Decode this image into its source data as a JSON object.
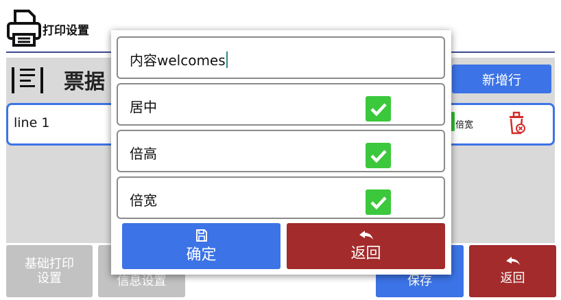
{
  "header": {
    "title": "打印设置"
  },
  "section": {
    "title": "票据",
    "add_line_label": "新增行"
  },
  "rows": [
    {
      "text": "line 1",
      "double_width_label": "倍宽"
    }
  ],
  "footer": {
    "basic_label_line1": "基础打印",
    "basic_label_line2": "设置",
    "info_label": "信息设置",
    "save_label": "保存",
    "back_label": "返回"
  },
  "dialog": {
    "content_value": "内容welcomes",
    "options": [
      {
        "label": "居中",
        "checked": true
      },
      {
        "label": "倍高",
        "checked": true
      },
      {
        "label": "倍宽",
        "checked": true
      }
    ],
    "confirm_label": "确定",
    "back_label": "返回"
  },
  "colors": {
    "primary": "#3c73e6",
    "danger": "#a32b2b",
    "check": "#3cc83c",
    "disabled": "#c2c2c2"
  }
}
